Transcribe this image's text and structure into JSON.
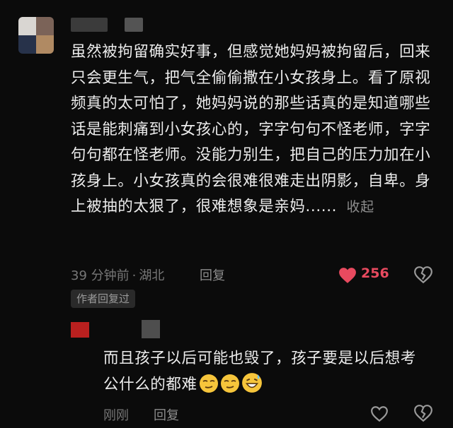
{
  "comment": {
    "text": "虽然被拘留确实好事，但感觉她妈妈被拘留后，回来只会更生气，把气全偷偷撒在小女孩身上。看了原视频真的太可怕了，她妈妈说的那些话真的是知道哪些话是能刺痛到小女孩心的，字字句句不怪老师，字字句句都在怪老师。没能力别生，把自己的压力加在小孩身上。小女孩真的会很难很难走出阴影，自卑。身上被抽的太狠了，很难想象是亲妈......",
    "collapse_label": "收起",
    "time": "39 分钟前",
    "location": "湖北",
    "reply_label": "回复",
    "like_count": "256",
    "author_badge": "作者回复过"
  },
  "reply": {
    "text": "而且孩子以后可能也毁了，孩子要是以后想考公什么的都难",
    "emojis": [
      "smirk-face-icon",
      "smirk-face-icon",
      "grin-sweat-face-icon"
    ],
    "time": "刚刚",
    "reply_label": "回复"
  },
  "colors": {
    "like": "#e84a5f",
    "background": "#0b0b0b"
  }
}
